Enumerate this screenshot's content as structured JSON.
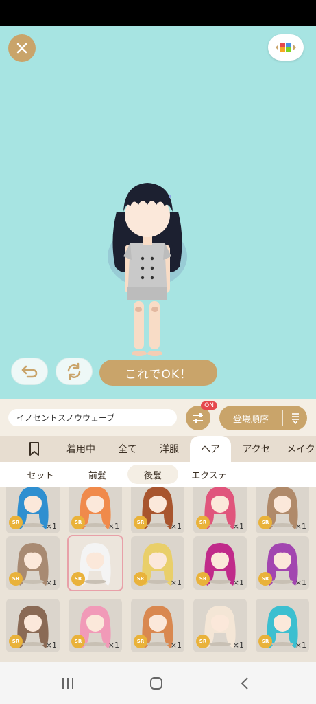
{
  "stage": {
    "ok_label": "これでOK！"
  },
  "toolbar": {
    "item_name": "イノセントスノウウェーブ",
    "filter_badge": "ON",
    "sort_label": "登場順序"
  },
  "category_tabs": [
    {
      "label": ""
    },
    {
      "label": "着用中"
    },
    {
      "label": "全て"
    },
    {
      "label": "洋服"
    },
    {
      "label": "ヘア"
    },
    {
      "label": "アクセ"
    },
    {
      "label": "メイク"
    }
  ],
  "sub_tabs": [
    {
      "label": "セット"
    },
    {
      "label": "前髪"
    },
    {
      "label": "後髪"
    },
    {
      "label": "エクステ"
    }
  ],
  "items": [
    {
      "rarity": "SR",
      "count": "×1",
      "hair_color": "#2f8fd0"
    },
    {
      "rarity": "SR",
      "count": "×1",
      "hair_color": "#f08a4b"
    },
    {
      "rarity": "SR",
      "count": "×1",
      "hair_color": "#a8552e"
    },
    {
      "rarity": "SR",
      "count": "×1",
      "hair_color": "#e0557c"
    },
    {
      "rarity": "SR",
      "count": "×1",
      "hair_color": "#b08a6a"
    },
    {
      "rarity": "SR",
      "count": "×1",
      "hair_color": "#a88a72"
    },
    {
      "rarity": "SR",
      "count": "",
      "hair_color": "#f4f4f4"
    },
    {
      "rarity": "SR",
      "count": "×1",
      "hair_color": "#e9cf6a"
    },
    {
      "rarity": "SR",
      "count": "×1",
      "hair_color": "#c02a8a"
    },
    {
      "rarity": "SR",
      "count": "×1",
      "hair_color": "#a246b0"
    },
    {
      "rarity": "SR",
      "count": "×1",
      "hair_color": "#8a6a55"
    },
    {
      "rarity": "SR",
      "count": "×1",
      "hair_color": "#f19ab8"
    },
    {
      "rarity": "SR",
      "count": "×1",
      "hair_color": "#d98850"
    },
    {
      "rarity": "SR",
      "count": "×1",
      "hair_color": "#f4e6d6"
    },
    {
      "rarity": "SR",
      "count": "×1",
      "hair_color": "#3cbfd0"
    }
  ],
  "colors": {
    "accent": "#c9a46a",
    "stage_bg": "#a7e4e2",
    "badge": "#e5484d"
  }
}
